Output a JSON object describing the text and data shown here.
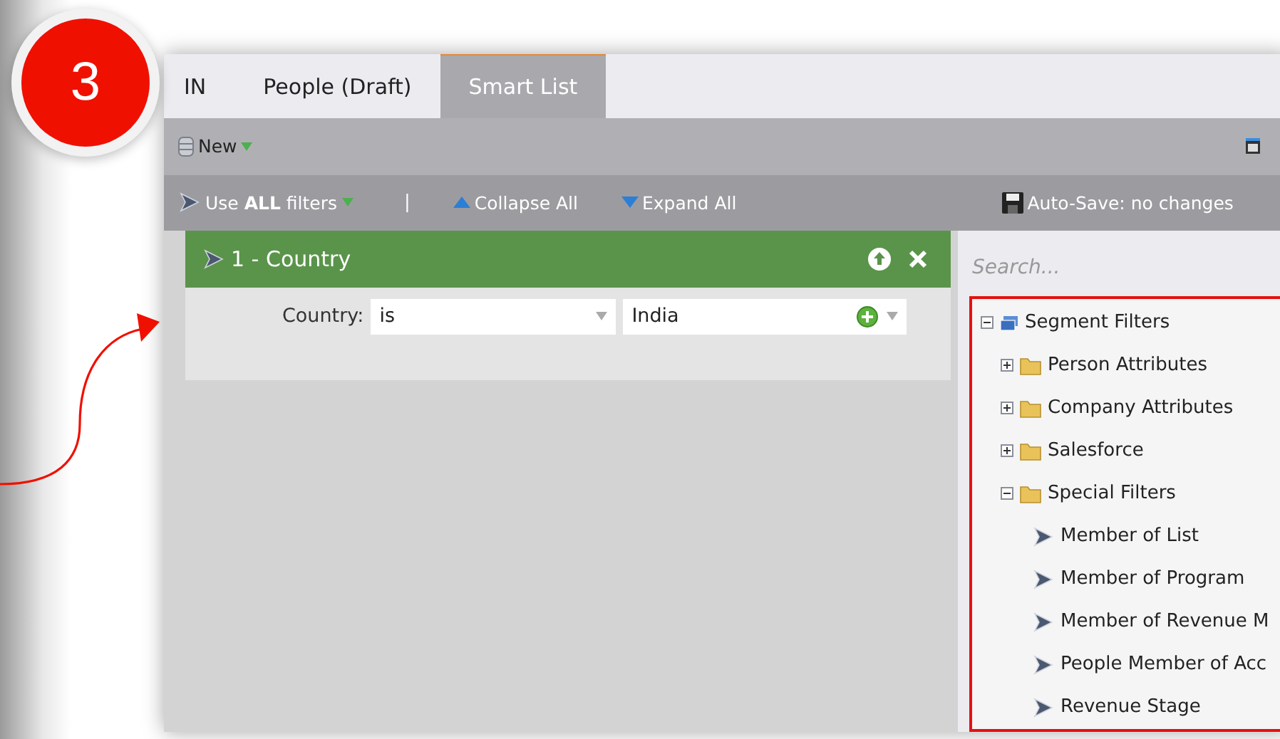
{
  "badge": "3",
  "tabs": [
    {
      "label": "IN",
      "selected": false
    },
    {
      "label": "People (Draft)",
      "selected": false
    },
    {
      "label": "Smart List",
      "selected": true
    }
  ],
  "toolbar": {
    "new_button": "New"
  },
  "filter_bar": {
    "logic": "Use **ALL** filters",
    "separator": "|",
    "collapse": "Collapse All",
    "expand": "Expand All",
    "autosave": "Auto-Save: no changes"
  },
  "filters": [
    {
      "title": "1 - Country",
      "field_label": "Country:",
      "operator": "is",
      "value": "India"
    }
  ],
  "search": {
    "placeholder": "Search..."
  },
  "tree": [
    {
      "label": "Segment Filters",
      "kind": "segment",
      "expanded": true,
      "children": [
        {
          "label": "Person Attributes",
          "kind": "folder",
          "expanded": false
        },
        {
          "label": "Company Attributes",
          "kind": "folder",
          "expanded": false
        },
        {
          "label": "Salesforce",
          "kind": "folder",
          "expanded": false
        },
        {
          "label": "Special Filters",
          "kind": "folder",
          "expanded": true,
          "children": [
            {
              "label": "Member of List",
              "kind": "filter"
            },
            {
              "label": "Member of Program",
              "kind": "filter"
            },
            {
              "label": "Member of Revenue M",
              "kind": "filter"
            },
            {
              "label": "People Member of Acc",
              "kind": "filter"
            },
            {
              "label": "Revenue Stage",
              "kind": "filter"
            }
          ]
        }
      ]
    }
  ]
}
